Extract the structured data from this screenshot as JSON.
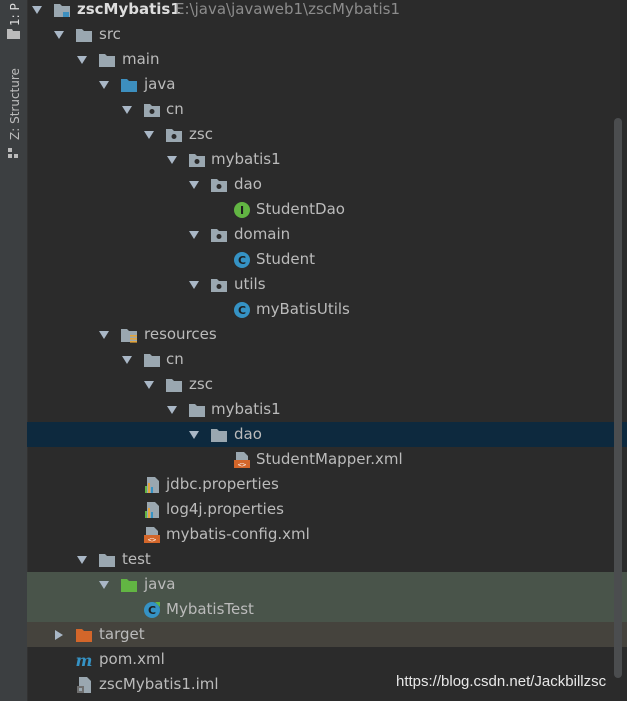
{
  "sidebar": {
    "project_tab": "1: P",
    "structure_tab": "Z: Structure"
  },
  "tree": {
    "root": {
      "name": "zscMybatis1",
      "path": "E:\\java\\javaweb1\\zscMybatis1"
    },
    "items": [
      {
        "label": "src",
        "icon": "folder-icon"
      },
      {
        "label": "main",
        "icon": "folder-icon"
      },
      {
        "label": "java",
        "icon": "source-folder-icon"
      },
      {
        "label": "cn",
        "icon": "package-icon"
      },
      {
        "label": "zsc",
        "icon": "package-icon"
      },
      {
        "label": "mybatis1",
        "icon": "package-icon"
      },
      {
        "label": "dao",
        "icon": "package-icon"
      },
      {
        "label": "StudentDao",
        "icon": "interface-icon"
      },
      {
        "label": "domain",
        "icon": "package-icon"
      },
      {
        "label": "Student",
        "icon": "class-icon"
      },
      {
        "label": "utils",
        "icon": "package-icon"
      },
      {
        "label": "myBatisUtils",
        "icon": "class-icon"
      },
      {
        "label": "resources",
        "icon": "resources-folder-icon"
      },
      {
        "label": "cn",
        "icon": "folder-icon"
      },
      {
        "label": "zsc",
        "icon": "folder-icon"
      },
      {
        "label": "mybatis1",
        "icon": "folder-icon"
      },
      {
        "label": "dao",
        "icon": "folder-icon"
      },
      {
        "label": "StudentMapper.xml",
        "icon": "xml-file-icon"
      },
      {
        "label": "jdbc.properties",
        "icon": "properties-file-icon"
      },
      {
        "label": "log4j.properties",
        "icon": "properties-file-icon"
      },
      {
        "label": "mybatis-config.xml",
        "icon": "xml-file-icon"
      },
      {
        "label": "test",
        "icon": "folder-icon"
      },
      {
        "label": "java",
        "icon": "test-source-folder-icon"
      },
      {
        "label": "MybatisTest",
        "icon": "test-class-icon"
      },
      {
        "label": "target",
        "icon": "excluded-folder-icon"
      },
      {
        "label": "pom.xml",
        "icon": "maven-icon"
      },
      {
        "label": "zscMybatis1.iml",
        "icon": "iml-file-icon"
      }
    ]
  },
  "colors": {
    "background": "#2b2b2b",
    "selection": "#0d293e",
    "test_highlight": "#49544a",
    "target_highlight": "#45433d",
    "folder": "#9aa7b0",
    "source_folder": "#3d8fbf",
    "test_folder": "#62b543",
    "excluded_folder": "#d3662a"
  },
  "watermark": "https://blog.csdn.net/Jackbillzsc"
}
